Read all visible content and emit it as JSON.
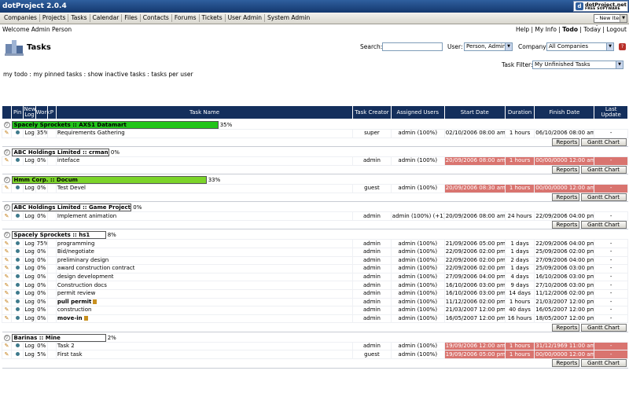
{
  "app": {
    "title": "dotProject 2.0.4",
    "brand_line1": "dotProject.net",
    "brand_line2": "FREE SOFTWARE",
    "new_item": "- New Item -"
  },
  "menu": [
    "Companies",
    "Projects",
    "Tasks",
    "Calendar",
    "Files",
    "Contacts",
    "Forums",
    "Tickets",
    "User Admin",
    "System Admin"
  ],
  "header": {
    "welcome": "Welcome Admin Person",
    "links": [
      {
        "label": "Help"
      },
      {
        "label": "My Info"
      },
      {
        "label": "Todo",
        "bold": true
      },
      {
        "label": "Today"
      },
      {
        "label": "Logout"
      }
    ]
  },
  "page": {
    "title": "Tasks"
  },
  "filters": {
    "search_label": "Search:",
    "search_value": "",
    "user_label": "User:",
    "user_value": "Person, Admin",
    "company_label": "Company:",
    "company_value": "All Companies",
    "taskfilter_label": "Task Filter:",
    "taskfilter_value": "My Unfinished Tasks"
  },
  "sublinks": [
    "my todo",
    "my pinned tasks",
    "show inactive tasks",
    "tasks per user"
  ],
  "table": {
    "headers": [
      "Pin",
      "New Log",
      "Work",
      "P",
      "Task Name",
      "Task Creator",
      "Assigned Users",
      "Start Date",
      "Duration",
      "Finish Date",
      "Last Update"
    ],
    "log_label": "Log",
    "reports_label": "Reports",
    "gantt_label": "Gantt Chart",
    "groups": [
      {
        "name": "Spacely Sprockets :: AXS1 Datamart",
        "percent": "35%",
        "progress": 0.35,
        "color": "#22c41a",
        "tasks": [
          {
            "work": "35%",
            "name": "Requirements Gathering",
            "creator": "super",
            "assigned": "admin (100%)",
            "start": "02/10/2006 08:00 am",
            "duration": "1 hours",
            "finish": "06/10/2006 08:00 am",
            "update": "-",
            "late": false
          }
        ]
      },
      {
        "name": "ABC Holdings Limited :: crman",
        "percent": "0%",
        "progress": 0,
        "color": "#ffffff",
        "tasks": [
          {
            "work": "0%",
            "name": "inteface",
            "creator": "admin",
            "assigned": "admin (100%)",
            "start": "20/09/2006 08:00 am",
            "duration": "1 hours",
            "finish": "00/00/0000 12:00 am",
            "update": "-",
            "late": true
          }
        ]
      },
      {
        "name": "Hmm Corp. :: Docum",
        "percent": "33%",
        "progress": 0.33,
        "color": "#7cd42a",
        "tasks": [
          {
            "work": "0%",
            "name": "Test Devel",
            "creator": "guest",
            "assigned": "admin (100%)",
            "start": "20/09/2006 08:30 am",
            "duration": "1 hours",
            "finish": "00/00/0000 12:00 am",
            "update": "-",
            "late": true
          }
        ]
      },
      {
        "name": "ABC Holdings Limited :: Game Project",
        "percent": "0%",
        "progress": 0,
        "color": "#ffffff",
        "tasks": [
          {
            "work": "0%",
            "name": "Implement animation",
            "creator": "admin",
            "assigned": "admin (100%) (+1)",
            "start": "20/09/2006 08:00 am",
            "duration": "24 hours",
            "finish": "22/09/2006 04:00 pm",
            "update": "-",
            "late": false
          }
        ]
      },
      {
        "name": "Spacely Sprockets :: hs1",
        "percent": "8%",
        "progress": 0.08,
        "color": "#ffffff",
        "tasks": [
          {
            "work": "75%",
            "name": "programming",
            "creator": "admin",
            "assigned": "admin (100%)",
            "start": "21/09/2006 05:00 pm",
            "duration": "1 days",
            "finish": "22/09/2006 04:00 pm",
            "update": "-",
            "late": false
          },
          {
            "work": "0%",
            "name": "Bid/negotiate",
            "creator": "admin",
            "assigned": "admin (100%)",
            "start": "22/09/2006 02:00 pm",
            "duration": "1 days",
            "finish": "25/09/2006 02:00 pm",
            "update": "-",
            "late": false
          },
          {
            "work": "0%",
            "name": "preliminary design",
            "creator": "admin",
            "assigned": "admin (100%)",
            "start": "22/09/2006 02:00 pm",
            "duration": "2 days",
            "finish": "27/09/2006 04:00 pm",
            "update": "-",
            "late": false
          },
          {
            "work": "0%",
            "name": "award construction contract",
            "creator": "admin",
            "assigned": "admin (100%)",
            "start": "22/09/2006 02:00 pm",
            "duration": "1 days",
            "finish": "25/09/2006 03:00 pm",
            "update": "-",
            "late": false
          },
          {
            "work": "0%",
            "name": "design development",
            "creator": "admin",
            "assigned": "admin (100%)",
            "start": "27/09/2006 04:00 pm",
            "duration": "4 days",
            "finish": "16/10/2006 03:00 pm",
            "update": "-",
            "late": false
          },
          {
            "work": "0%",
            "name": "Construction docs",
            "creator": "admin",
            "assigned": "admin (100%)",
            "start": "16/10/2006 03:00 pm",
            "duration": "9 days",
            "finish": "27/10/2006 03:00 pm",
            "update": "-",
            "late": false
          },
          {
            "work": "0%",
            "name": "permit review",
            "creator": "admin",
            "assigned": "admin (100%)",
            "start": "16/10/2006 03:00 pm",
            "duration": "14 days",
            "finish": "11/12/2006 02:00 pm",
            "update": "-",
            "late": false
          },
          {
            "work": "0%",
            "name": "pull permit",
            "creator": "admin",
            "assigned": "admin (100%)",
            "start": "11/12/2006 02:00 pm",
            "duration": "1 hours",
            "finish": "21/03/2007 12:00 pm",
            "update": "-",
            "late": false,
            "bold": true
          },
          {
            "work": "0%",
            "name": "construction",
            "creator": "admin",
            "assigned": "admin (100%)",
            "start": "21/03/2007 12:00 pm",
            "duration": "40 days",
            "finish": "16/05/2007 12:00 pm",
            "update": "-",
            "late": false
          },
          {
            "work": "0%",
            "name": "move-in",
            "creator": "admin",
            "assigned": "admin (100%)",
            "start": "16/05/2007 12:00 pm",
            "duration": "16 hours",
            "finish": "18/05/2007 12:00 pm",
            "update": "-",
            "late": false,
            "bold": true
          }
        ]
      },
      {
        "name": "Barinas :: Mine",
        "percent": "2%",
        "progress": 0.02,
        "color": "#ffffff",
        "tasks": [
          {
            "work": "0%",
            "name": "Task 2",
            "creator": "admin",
            "assigned": "admin (100%)",
            "start": "19/09/2006 12:00 am",
            "duration": "1 hours",
            "finish": "31/12/1969 11:00 am",
            "update": "-",
            "late": true
          },
          {
            "work": "5%",
            "name": "First task",
            "creator": "guest",
            "assigned": "admin (100%)",
            "start": "19/09/2006 05:00 pm",
            "duration": "1 hours",
            "finish": "00/00/0000 12:00 am",
            "update": "-",
            "late": true
          }
        ]
      }
    ]
  }
}
